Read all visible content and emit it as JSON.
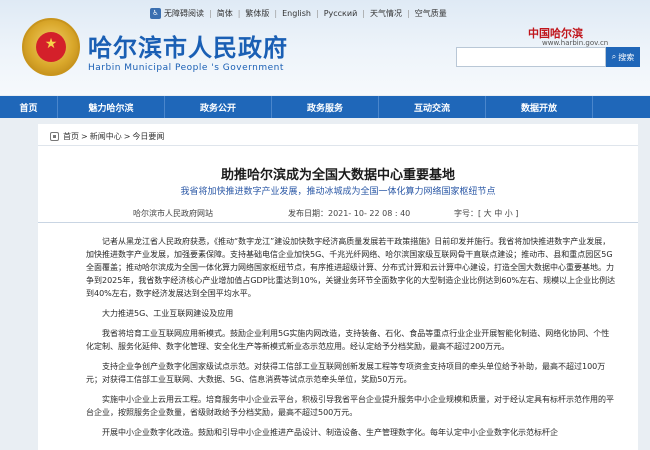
{
  "header": {
    "topbar": {
      "accessibility": "无障碍阅读",
      "simplified": "简体",
      "traditional": "繁体版",
      "english": "English",
      "russian": "Русский",
      "weather": "天气情况",
      "air": "空气质量"
    },
    "title": "哈尔滨市人民政府",
    "subtitle": "Harbin Municipal People 's Government",
    "brand_mark": "中国哈尔滨",
    "brand_url": "www.harbin.gov.cn",
    "search": {
      "value": "",
      "button_label": "搜索"
    }
  },
  "nav": {
    "items": [
      "首页",
      "魅力哈尔滨",
      "政务公开",
      "政务服务",
      "互动交流",
      "数据开放"
    ]
  },
  "breadcrumb": {
    "home": "首页",
    "sep": ">",
    "level1": "新闻中心",
    "level2": "今日要闻"
  },
  "article": {
    "title": "助推哈尔滨成为全国大数据中心重要基地",
    "subtitle": "我省将加快推进数字产业发展，推动冰城成为全国一体化算力网络国家枢纽节点",
    "source": "哈尔滨市人民政府网站",
    "publish_label": "发布日期：",
    "publish_time": "2021- 10- 22    08 : 40",
    "font_size_label": "字号：[ 大 中 小 ]",
    "paragraphs": [
      "记者从黑龙江省人民政府获悉，《推动“数字龙江”建设加快数字经济高质量发展若干政策措施》日前印发并施行。我省将加快推进数字产业发展，加快推进数字产业发展，加强要素保障。支持基础电信企业加快5G、千兆光纤网络、哈尔滨国家级互联网骨干直联点建设；推动市、县和重点园区5G全面覆盖；推动哈尔滨成为全国一体化算力网络国家枢纽节点，有序推进超级计算、分布式计算和云计算中心建设，打造全国大数据中心重要基地。力争到2025年，我省数字经济核心产业增加值占GDP比重达到10%，关键业务环节全面数字化的大型制造企业比例达到60%左右、规模以上企业比例达到40%左右，数字经济发展达到全国平均水平。",
      "大力推进5G、工业互联网建设及应用",
      "我省将培育工业互联网应用新模式。鼓励企业利用5G实施内网改造，支持装备、石化、食品等重点行业企业开展智能化制造、网络化协同、个性化定制、服务化延伸、数字化管理、安全化生产等新模式新业态示范应用。经认定给予分档奖励，最高不超过200万元。",
      "支持企业争创产业数字化国家级试点示范。对获得工信部工业互联网创新发展工程等专项资金支持项目的牵头单位给予补助，最高不超过100万元；对获得工信部工业互联网、大数据、5G、信息消费等试点示范牵头单位，奖励50万元。",
      "实施中小企业上云用云工程。培育服务中小企业云平台，积极引导我省平台企业提升服务中小企业规模和质量，对于经认定具有标杆示范作用的平台企业，按照服务企业数量，省级财政给予分档奖励，最高不超过500万元。",
      "开展中小企业数字化改造。鼓励和引导中小企业推进产品设计、制造设备、生产管理数字化。每年认定中小企业数字化示范标杆企"
    ]
  }
}
